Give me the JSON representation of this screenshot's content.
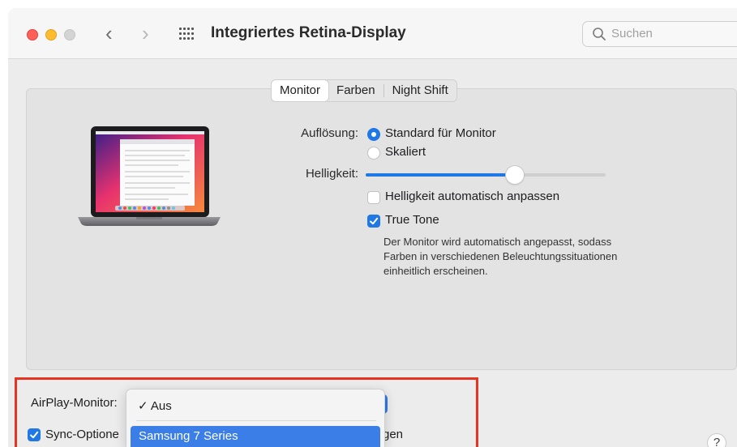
{
  "window": {
    "title": "Integriertes Retina-Display",
    "nav_back": "‹",
    "nav_forward": "›",
    "search_placeholder": "Suchen",
    "icons": [
      "close-icon",
      "minimize-icon",
      "zoom-icon",
      "chevron-left-icon",
      "chevron-right-icon",
      "grid-icon",
      "search-icon"
    ]
  },
  "tabs": [
    {
      "label": "Monitor",
      "active": true
    },
    {
      "label": "Farben",
      "active": false
    },
    {
      "label": "Night Shift",
      "active": false
    }
  ],
  "monitor": {
    "resolution_label": "Auflösung:",
    "resolution_options": [
      {
        "label": "Standard für Monitor",
        "selected": true
      },
      {
        "label": "Skaliert",
        "selected": false
      }
    ],
    "brightness_label": "Helligkeit:",
    "brightness_level": 0.62,
    "auto_brightness": {
      "label": "Helligkeit automatisch anpassen",
      "checked": false
    },
    "true_tone": {
      "label": "True Tone",
      "checked": true
    },
    "true_tone_description": "Der Monitor wird automatisch angepasst, sodass Farben in verschiedenen Beleuchtungssituationen einheitlich erscheinen."
  },
  "bottom": {
    "airplay_label": "AirPlay-Monitor:",
    "sync_label": "Sync-Optione",
    "sync_checked": true,
    "sync_suffix": "gen",
    "help": "?"
  },
  "airplay_dropdown": {
    "items": [
      {
        "label": "✓ Aus",
        "checked": true
      },
      {
        "label": "Samsung 7 Series",
        "highlighted": true
      }
    ]
  },
  "colors": {
    "accent": "#1f78e6",
    "highlight_box": "#e63323",
    "traffic_red": "#fe5f57",
    "traffic_yellow": "#febc2e"
  }
}
